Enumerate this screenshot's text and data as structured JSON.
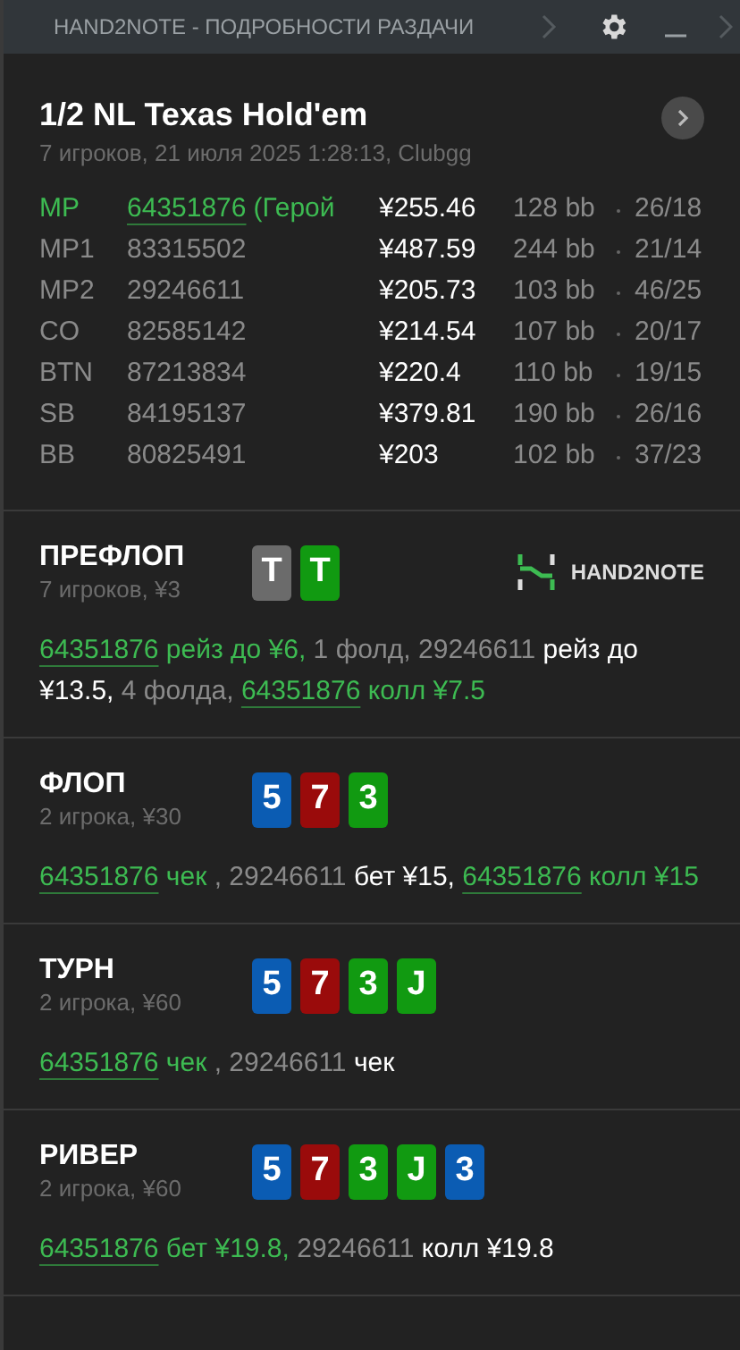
{
  "window": {
    "title": "HAND2NOTE - ПОДРОБНОСТИ РАЗДАЧИ"
  },
  "hand": {
    "title": "1/2 NL Texas Hold'em",
    "subtitle": "7 игроков, 21 июля 2025 1:28:13, Clubgg"
  },
  "players": [
    {
      "position": "MP",
      "name": "64351876",
      "note": "(Герой",
      "stack": "¥255.46",
      "bb": "128 bb",
      "stats": "26/18",
      "hero": true
    },
    {
      "position": "MP1",
      "name": "83315502",
      "stack": "¥487.59",
      "bb": "244 bb",
      "stats": "21/14",
      "hero": false
    },
    {
      "position": "MP2",
      "name": "29246611",
      "stack": "¥205.73",
      "bb": "103 bb",
      "stats": "46/25",
      "hero": false
    },
    {
      "position": "CO",
      "name": "82585142",
      "stack": "¥214.54",
      "bb": "107 bb",
      "stats": "20/17",
      "hero": false
    },
    {
      "position": "BTN",
      "name": "87213834",
      "stack": "¥220.4",
      "bb": "110 bb",
      "stats": "19/15",
      "hero": false
    },
    {
      "position": "SB",
      "name": "84195137",
      "stack": "¥379.81",
      "bb": "190 bb",
      "stats": "26/16",
      "hero": false
    },
    {
      "position": "BB",
      "name": "80825491",
      "stack": "¥203",
      "bb": "102 bb",
      "stats": "37/23",
      "hero": false
    }
  ],
  "streets": [
    {
      "name": "ПРЕФЛОП",
      "info": "7 игроков, ¥3",
      "logo": "HAND2NOTE",
      "cards": [
        {
          "rank": "T",
          "color": "#6b6b6b"
        },
        {
          "rank": "T",
          "color": "#119a11"
        }
      ],
      "actions": [
        {
          "text": "64351876",
          "kind": "link"
        },
        {
          "text": " рейз до ¥6,",
          "kind": "hero"
        },
        {
          "text": " 1 фолд, 29246611",
          "kind": "muted"
        },
        {
          "text": " рейз до ¥13.5,",
          "kind": "plain"
        },
        {
          "text": " 4 фолда, ",
          "kind": "muted"
        },
        {
          "text": "64351876",
          "kind": "link"
        },
        {
          "text": " колл ¥7.5",
          "kind": "hero"
        }
      ]
    },
    {
      "name": "ФЛОП",
      "info": "2 игрока, ¥30",
      "cards": [
        {
          "rank": "5",
          "color": "#0b5cb3"
        },
        {
          "rank": "7",
          "color": "#9a0b0b"
        },
        {
          "rank": "3",
          "color": "#119a11"
        }
      ],
      "actions": [
        {
          "text": "64351876",
          "kind": "link"
        },
        {
          "text": " чек ",
          "kind": "hero"
        },
        {
          "text": ", 29246611",
          "kind": "muted"
        },
        {
          "text": " бет ¥15, ",
          "kind": "plain"
        },
        {
          "text": "64351876",
          "kind": "link"
        },
        {
          "text": " колл ¥15",
          "kind": "hero"
        }
      ]
    },
    {
      "name": "ТУРН",
      "info": "2 игрока, ¥60",
      "cards": [
        {
          "rank": "5",
          "color": "#0b5cb3"
        },
        {
          "rank": "7",
          "color": "#9a0b0b"
        },
        {
          "rank": "3",
          "color": "#119a11"
        },
        {
          "rank": "J",
          "color": "#119a11"
        }
      ],
      "actions": [
        {
          "text": "64351876",
          "kind": "link"
        },
        {
          "text": " чек ",
          "kind": "hero"
        },
        {
          "text": ", 29246611",
          "kind": "muted"
        },
        {
          "text": " чек",
          "kind": "plain"
        }
      ]
    },
    {
      "name": "РИВЕР",
      "info": "2 игрока, ¥60",
      "cards": [
        {
          "rank": "5",
          "color": "#0b5cb3"
        },
        {
          "rank": "7",
          "color": "#9a0b0b"
        },
        {
          "rank": "3",
          "color": "#119a11"
        },
        {
          "rank": "J",
          "color": "#119a11"
        },
        {
          "rank": "3",
          "color": "#0b5cb3"
        }
      ],
      "actions": [
        {
          "text": "64351876",
          "kind": "link"
        },
        {
          "text": " бет ¥19.8,",
          "kind": "hero"
        },
        {
          "text": " 29246611",
          "kind": "muted"
        },
        {
          "text": " колл ¥19.8",
          "kind": "plain"
        }
      ]
    }
  ]
}
